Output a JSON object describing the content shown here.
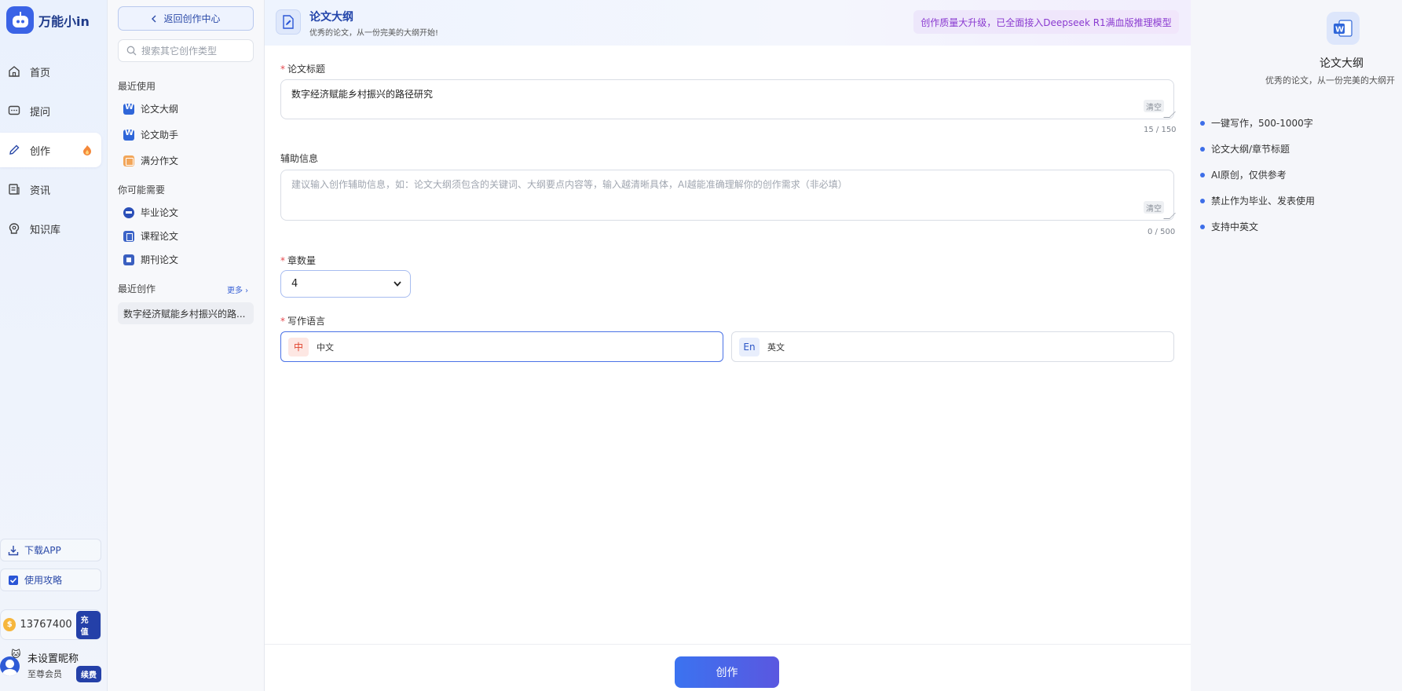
{
  "app": {
    "name": "万能小in"
  },
  "nav": {
    "items": [
      {
        "label": "首页",
        "icon": "home-icon"
      },
      {
        "label": "提问",
        "icon": "chat-icon"
      },
      {
        "label": "创作",
        "icon": "pen-icon"
      },
      {
        "label": "资讯",
        "icon": "news-icon"
      },
      {
        "label": "知识库",
        "icon": "knowledge-icon"
      }
    ],
    "download_app": "下载APP",
    "guide": "使用攻略",
    "points": "13767400",
    "recharge": "充值",
    "user_name": "未设置昵称",
    "user_level": "至尊会员",
    "renew": "续费"
  },
  "category": {
    "back_label": "返回创作中心",
    "search_placeholder": "搜索其它创作类型",
    "recent_title": "最近使用",
    "recent": [
      "论文大纲",
      "论文助手",
      "满分作文"
    ],
    "maybe_title": "你可能需要",
    "maybe": [
      "毕业论文",
      "课程论文",
      "期刊论文"
    ],
    "recent_creations_title": "最近创作",
    "more_label": "更多",
    "recent_creation": "数字经济赋能乡村振兴的路..."
  },
  "header": {
    "title": "论文大纲",
    "subtitle": "优秀的论文，从一份完美的大纲开始!",
    "banner": "创作质量大升级，已全面接入Deepseek R1满血版推理模型"
  },
  "form": {
    "title_label": "论文标题",
    "title_value": "数字经济赋能乡村振兴的路径研究",
    "title_counter": "15 / 150",
    "clear_label": "清空",
    "aux_label": "辅助信息",
    "aux_placeholder": "建议输入创作辅助信息，如：论文大纲须包含的关键词、大纲要点内容等，输入越清晰具体，AI越能准确理解你的创作需求（非必填）",
    "aux_counter": "0 / 500",
    "chapters_label": "章数量",
    "chapters_value": "4",
    "language_label": "写作语言",
    "lang_zh_badge": "中",
    "lang_zh": "中文",
    "lang_en_badge": "En",
    "lang_en": "英文",
    "submit": "创作"
  },
  "info": {
    "title": "论文大纲",
    "subtitle": "优秀的论文，从一份完美的大纲开",
    "features": [
      "一键写作，500-1000字",
      "论文大纲/章节标题",
      "AI原创，仅供参考",
      "禁止作为毕业、发表使用",
      "支持中英文"
    ]
  },
  "colors": {
    "accent": "#3b63e6",
    "banner_text": "#8a3ad0",
    "required": "#e5484d"
  }
}
